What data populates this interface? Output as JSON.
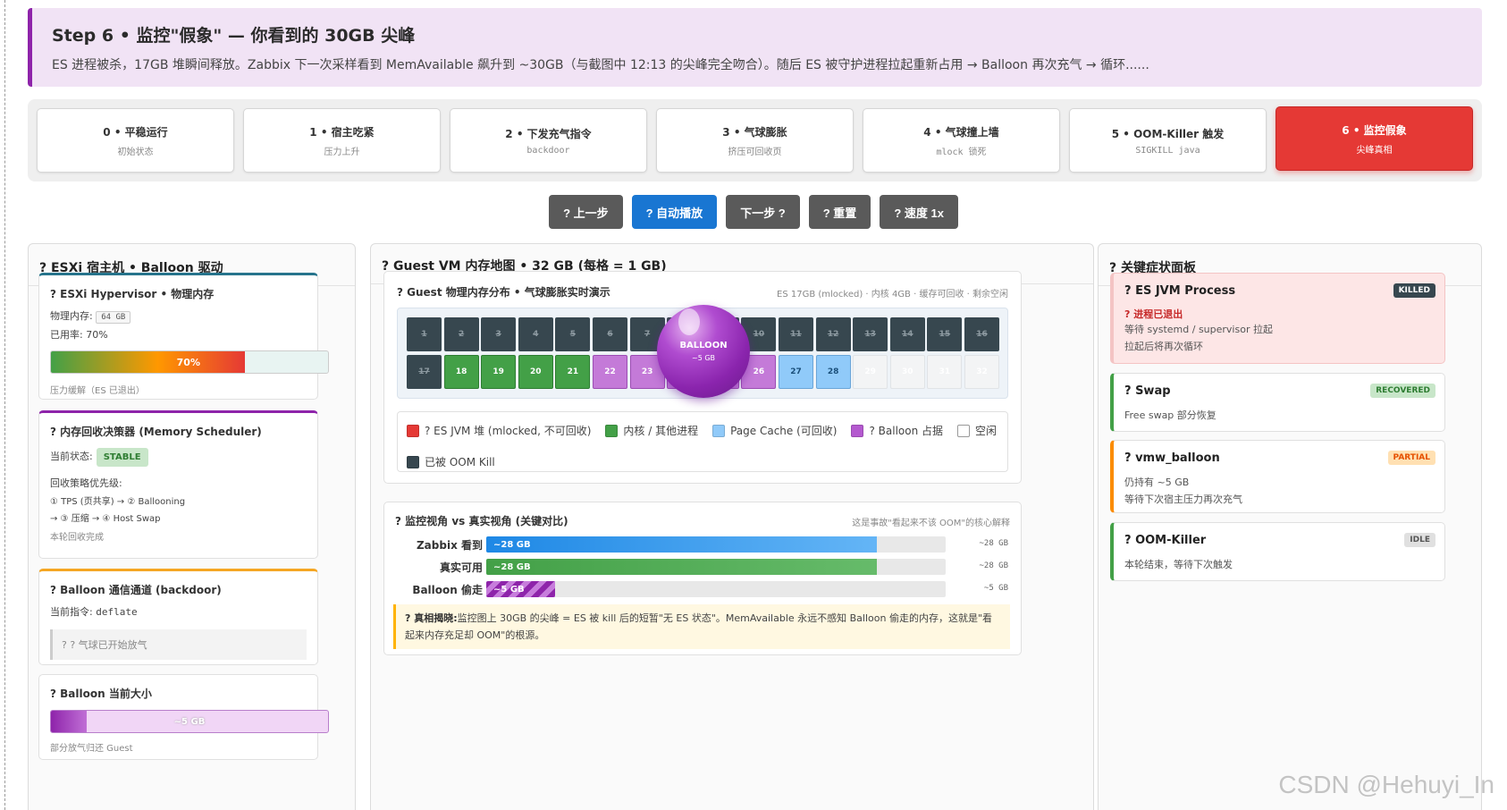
{
  "banner": {
    "title": "Step 6 • 监控\"假象\" — 你看到的 30GB 尖峰",
    "desc": "ES 进程被杀，17GB 堆瞬间释放。Zabbix 下一次采样看到 MemAvailable 飙升到 ~30GB（与截图中 12:13 的尖峰完全吻合）。随后 ES 被守护进程拉起重新占用 → Balloon 再次充气 → 循环......"
  },
  "steps": [
    {
      "title": "0 • 平稳运行",
      "sub": "初始状态"
    },
    {
      "title": "1 • 宿主吃紧",
      "sub": "压力上升"
    },
    {
      "title": "2 • 下发充气指令",
      "sub": "backdoor"
    },
    {
      "title": "3 • 气球膨胀",
      "sub": "挤压可回收页"
    },
    {
      "title": "4 • 气球撞上墙",
      "sub": "mlock 锁死"
    },
    {
      "title": "5 • OOM-Killer 触发",
      "sub": "SIGKILL java"
    },
    {
      "title": "6 • 监控假象",
      "sub": "尖峰真相"
    }
  ],
  "controls": {
    "prev": "? 上一步",
    "auto": "? 自动播放",
    "next": "下一步 ?",
    "reset": "? 重置",
    "speed": "? 速度 1x"
  },
  "left": {
    "title": "? ESXi 宿主机 • Balloon 驱动",
    "hyper": {
      "title": "? ESXi Hypervisor • 物理内存",
      "mem_label": "物理内存:",
      "mem_value": "64 GB",
      "usage": "已用率: 70%",
      "bar_label": "70%",
      "bar_percent": 70,
      "note": "压力缓解（ES 已退出）"
    },
    "scheduler": {
      "title": "? 内存回收决策器 (Memory Scheduler)",
      "state_label": "当前状态:",
      "state": "STABLE",
      "priority_label": "回收策略优先级:",
      "priority1": "① TPS (页共享) → ② Ballooning",
      "priority2": "→ ③ 压缩 → ④ Host Swap",
      "note": "本轮回收完成"
    },
    "channel": {
      "title": "? Balloon 通信通道 (backdoor)",
      "cmd_label": "当前指令:",
      "cmd": "deflate",
      "msg": "? ? 气球已开始放气"
    },
    "size": {
      "title": "? Balloon 当前大小",
      "label": "~5 GB",
      "fill_fraction": 0.13,
      "note": "部分放气归还 Guest"
    }
  },
  "mid": {
    "title": "? Guest VM 内存地图 • 32 GB (每格 = 1 GB)",
    "map": {
      "title": "? Guest 物理内存分布 • 气球膨胀实时演示",
      "legend_hint": "ES 17GB (mlocked) · 内核 4GB · 缓存可回收 · 剩余空闲",
      "cells": [
        {
          "n": "1",
          "kind": "kill"
        },
        {
          "n": "2",
          "kind": "kill"
        },
        {
          "n": "3",
          "kind": "kill"
        },
        {
          "n": "4",
          "kind": "kill"
        },
        {
          "n": "5",
          "kind": "kill"
        },
        {
          "n": "6",
          "kind": "kill"
        },
        {
          "n": "7",
          "kind": "kill"
        },
        {
          "n": "8",
          "kind": "kill"
        },
        {
          "n": "9",
          "kind": "kill"
        },
        {
          "n": "10",
          "kind": "kill"
        },
        {
          "n": "11",
          "kind": "kill"
        },
        {
          "n": "12",
          "kind": "kill"
        },
        {
          "n": "13",
          "kind": "kill"
        },
        {
          "n": "14",
          "kind": "kill"
        },
        {
          "n": "15",
          "kind": "kill"
        },
        {
          "n": "16",
          "kind": "kill"
        },
        {
          "n": "17",
          "kind": "kill"
        },
        {
          "n": "18",
          "kind": "green"
        },
        {
          "n": "19",
          "kind": "green"
        },
        {
          "n": "20",
          "kind": "green"
        },
        {
          "n": "21",
          "kind": "green"
        },
        {
          "n": "22",
          "kind": "purple"
        },
        {
          "n": "23",
          "kind": "purple"
        },
        {
          "n": "24",
          "kind": "purple"
        },
        {
          "n": "25",
          "kind": "purple"
        },
        {
          "n": "26",
          "kind": "purple"
        },
        {
          "n": "27",
          "kind": "blue"
        },
        {
          "n": "28",
          "kind": "blue"
        },
        {
          "n": "29",
          "kind": "empty"
        },
        {
          "n": "30",
          "kind": "empty"
        },
        {
          "n": "31",
          "kind": "empty"
        },
        {
          "n": "32",
          "kind": "empty"
        }
      ],
      "balloon_label": "BALLOON",
      "balloon_size": "~5 GB"
    },
    "legend": [
      {
        "label": "? ES JVM 堆 (mlocked, 不可回收)",
        "color": "#e53935"
      },
      {
        "label": "内核 / 其他进程",
        "color": "#43a047"
      },
      {
        "label": "Page Cache (可回收)",
        "color": "#90caf9"
      },
      {
        "label": "? Balloon 占据",
        "color": "#b459cf"
      },
      {
        "label": "空闲",
        "color": "#ffffff"
      },
      {
        "label": "已被 OOM Kill",
        "color": "#37474f"
      }
    ],
    "compare": {
      "title": "? 监控视角 vs 真实视角 (关键对比)",
      "hint": "这是事故\"看起来不该 OOM\"的核心解释",
      "rows": [
        {
          "label": "Zabbix 看到",
          "bar_text": "~28 GB",
          "value": "~28 GB",
          "fraction": 0.85,
          "color": "#1e88e5"
        },
        {
          "label": "真实可用",
          "bar_text": "~28 GB",
          "value": "~28 GB",
          "fraction": 0.85,
          "color": "#43a047"
        },
        {
          "label": "Balloon 偷走",
          "bar_text": "~5 GB",
          "value": "~5 GB",
          "fraction": 0.15,
          "color": "#8e24aa"
        }
      ],
      "note_bold": "? 真相揭晓:",
      "note_text": "监控图上 30GB 的尖峰 = ES 被 kill 后的短暂\"无 ES 状态\"。MemAvailable 永远不感知 Balloon 偷走的内存，这就是\"看起来内存充足却 OOM\"的根源。"
    }
  },
  "right": {
    "title": "? 关键症状面板",
    "cards": [
      {
        "title": "? ES JVM Process",
        "badge": "KILLED",
        "red": "? 进程已退出",
        "lines": [
          "等待 systemd / supervisor 拉起",
          "拉起后将再次循环"
        ]
      },
      {
        "title": "? Swap",
        "badge": "RECOVERED",
        "red": "",
        "lines": [
          "Free swap 部分恢复"
        ]
      },
      {
        "title": "? vmw_balloon",
        "badge": "PARTIAL",
        "red": "",
        "lines": [
          "仍持有 ~5 GB",
          "等待下次宿主压力再次充气"
        ]
      },
      {
        "title": "? OOM-Killer",
        "badge": "IDLE",
        "red": "",
        "lines": [
          "本轮结束，等待下次触发"
        ]
      }
    ]
  },
  "watermark": "CSDN @Hehuyi_In"
}
